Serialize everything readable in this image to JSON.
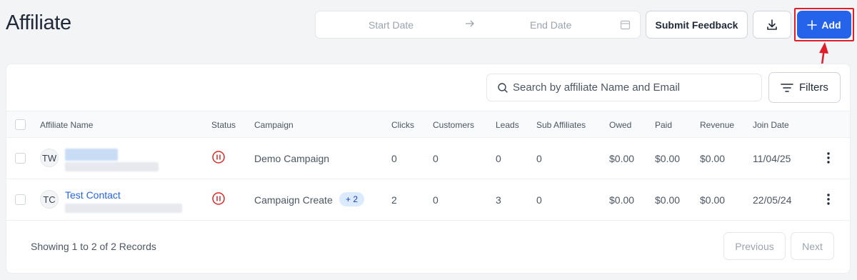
{
  "page": {
    "title": "Affiliate"
  },
  "toolbar": {
    "start_date_placeholder": "Start Date",
    "end_date_placeholder": "End Date",
    "feedback_label": "Submit Feedback",
    "add_label": "Add",
    "accent_color": "#2563eb",
    "highlight_color": "#e11d2a"
  },
  "filters": {
    "search_placeholder": "Search by affiliate Name and Email",
    "filters_label": "Filters"
  },
  "table": {
    "columns": [
      "Affiliate Name",
      "Status",
      "Campaign",
      "Clicks",
      "Customers",
      "Leads",
      "Sub Affiliates",
      "Owed",
      "Paid",
      "Revenue",
      "Join Date"
    ],
    "rows": [
      {
        "initials": "TW",
        "name": "",
        "campaign": "Demo Campaign",
        "campaign_extra": "",
        "clicks": "0",
        "customers": "0",
        "leads": "0",
        "sub_affiliates": "0",
        "owed": "$0.00",
        "paid": "$0.00",
        "revenue": "$0.00",
        "join_date": "11/04/25",
        "status_icon": "pause-circle-icon"
      },
      {
        "initials": "TC",
        "name": "Test Contact",
        "campaign": "Campaign Create",
        "campaign_extra": "+ 2",
        "clicks": "2",
        "customers": "0",
        "leads": "3",
        "sub_affiliates": "0",
        "owed": "$0.00",
        "paid": "$0.00",
        "revenue": "$0.00",
        "join_date": "22/05/24",
        "status_icon": "pause-circle-icon"
      }
    ]
  },
  "footer": {
    "records_text": "Showing 1 to 2 of 2 Records",
    "previous_label": "Previous",
    "next_label": "Next"
  }
}
